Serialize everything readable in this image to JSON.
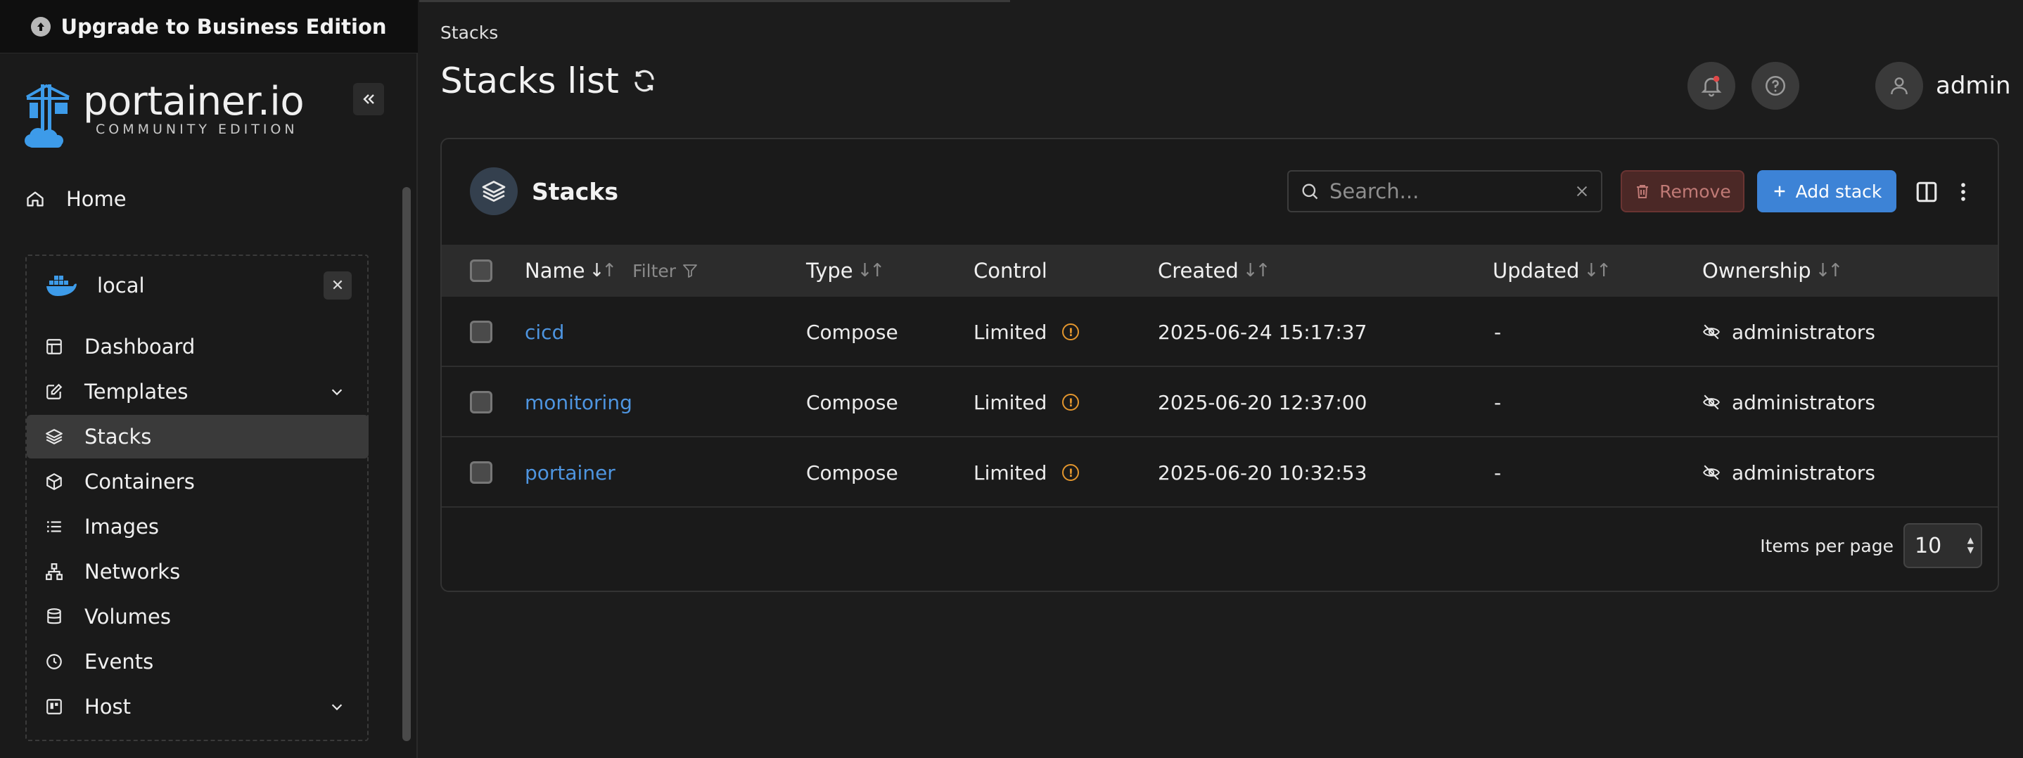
{
  "banner": {
    "upgrade_label": "Upgrade to Business Edition"
  },
  "sidebar": {
    "logo_text": "portainer.io",
    "logo_sub": "COMMUNITY EDITION",
    "home_label": "Home",
    "environment": {
      "name": "local"
    },
    "items": [
      {
        "label": "Dashboard"
      },
      {
        "label": "Templates"
      },
      {
        "label": "Stacks"
      },
      {
        "label": "Containers"
      },
      {
        "label": "Images"
      },
      {
        "label": "Networks"
      },
      {
        "label": "Volumes"
      },
      {
        "label": "Events"
      },
      {
        "label": "Host"
      }
    ]
  },
  "header": {
    "breadcrumb": "Stacks",
    "title": "Stacks list",
    "username": "admin"
  },
  "panel": {
    "title": "Stacks",
    "search_placeholder": "Search...",
    "remove_label": "Remove",
    "add_label": "Add stack"
  },
  "table": {
    "columns": {
      "name": "Name",
      "filter": "Filter",
      "type": "Type",
      "control": "Control",
      "created": "Created",
      "updated": "Updated",
      "ownership": "Ownership"
    },
    "rows": [
      {
        "name": "cicd",
        "type": "Compose",
        "control": "Limited",
        "created": "2025-06-24 15:17:37",
        "updated": "-",
        "ownership": "administrators"
      },
      {
        "name": "monitoring",
        "type": "Compose",
        "control": "Limited",
        "created": "2025-06-20 12:37:00",
        "updated": "-",
        "ownership": "administrators"
      },
      {
        "name": "portainer",
        "type": "Compose",
        "control": "Limited",
        "created": "2025-06-20 10:32:53",
        "updated": "-",
        "ownership": "administrators"
      }
    ],
    "items_per_page_label": "Items per page",
    "items_per_page": "10"
  },
  "colors": {
    "accent": "#3d83d6",
    "link": "#4e95e0",
    "warning": "#e3962e",
    "danger": "#4b2826"
  }
}
